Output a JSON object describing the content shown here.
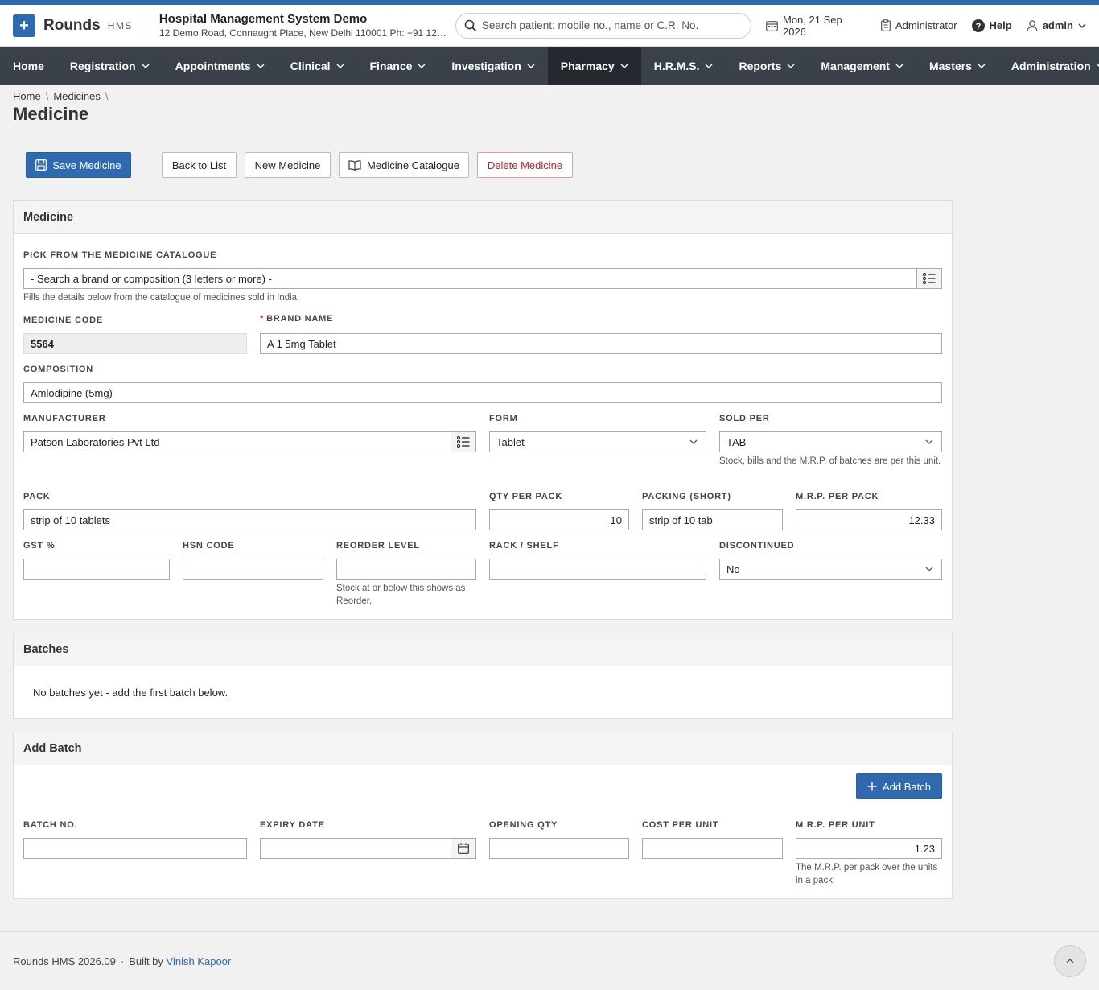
{
  "header": {
    "app_name": "Rounds",
    "app_sub": "HMS",
    "org_name": "Hospital Management System Demo",
    "org_address": "12 Demo Road, Connaught Place, New Delhi 110001 Ph: +91 123...",
    "search_placeholder": "Search patient: mobile no., name or C.R. No.",
    "date": "Mon, 21 Sep 2026",
    "role": "Administrator",
    "help": "Help",
    "user": "admin"
  },
  "nav": {
    "items": [
      {
        "label": "Home"
      },
      {
        "label": "Registration"
      },
      {
        "label": "Appointments"
      },
      {
        "label": "Clinical"
      },
      {
        "label": "Finance"
      },
      {
        "label": "Investigation"
      },
      {
        "label": "Pharmacy"
      },
      {
        "label": "H.R.M.S."
      },
      {
        "label": "Reports"
      },
      {
        "label": "Management"
      },
      {
        "label": "Masters"
      },
      {
        "label": "Administration"
      }
    ]
  },
  "breadcrumb": {
    "items": [
      "Home",
      "Medicines"
    ]
  },
  "page_title": "Medicine",
  "toolbar": {
    "save": "Save Medicine",
    "back": "Back to List",
    "new": "New Medicine",
    "catalogue": "Medicine Catalogue",
    "delete": "Delete Medicine"
  },
  "medicine": {
    "title": "Medicine",
    "pick_label": "Pick from the medicine catalogue",
    "pick_value": "- Search a brand or composition (3 letters or more) -",
    "pick_help": "Fills the details below from the catalogue of medicines sold in India.",
    "code_label": "Medicine Code",
    "code_value": "5564",
    "brand_label": "Brand Name",
    "brand_value": "A 1 5mg Tablet",
    "composition_label": "Composition",
    "composition_value": "Amlodipine (5mg)",
    "manufacturer_label": "Manufacturer",
    "manufacturer_value": "Patson Laboratories Pvt Ltd",
    "form_label": "Form",
    "form_value": "Tablet",
    "sold_per_label": "Sold per",
    "sold_per_value": "TAB",
    "sold_per_help": "Stock, bills and the M.R.P. of batches are per this unit.",
    "pack_label": "Pack",
    "pack_value": "strip of 10 tablets",
    "qty_label": "Qty per pack",
    "qty_value": "10",
    "packing_label": "Packing (short)",
    "packing_value": "strip of 10 tab",
    "mrp_pack_label": "M.R.P. per pack",
    "mrp_pack_value": "12.33",
    "gst_label": "GST %",
    "gst_value": "",
    "hsn_label": "HSN Code",
    "hsn_value": "",
    "reorder_label": "Reorder Level",
    "reorder_value": "",
    "reorder_help": "Stock at or below this shows as Reorder.",
    "rack_label": "Rack / Shelf",
    "rack_value": "",
    "discontinued_label": "Discontinued",
    "discontinued_value": "No"
  },
  "batches": {
    "title": "Batches",
    "empty": "No batches yet - add the first batch below."
  },
  "add_batch": {
    "title": "Add Batch",
    "button": "Add Batch",
    "batch_no_label": "Batch No.",
    "batch_no_value": "",
    "expiry_label": "Expiry Date",
    "expiry_value": "",
    "opening_qty_label": "Opening Qty",
    "opening_qty_value": "",
    "cost_label": "Cost per Unit",
    "cost_value": "",
    "mrp_unit_label": "M.R.P. per Unit",
    "mrp_unit_value": "1.23",
    "mrp_unit_help": "The M.R.P. per pack over the units in a pack."
  },
  "footer": {
    "text": "Rounds HMS 2026.09",
    "built_by": "Built by",
    "author": "Vinish Kapoor"
  },
  "colors": {
    "accent": "#2e6aad",
    "nav": "#3a4148",
    "nav_active": "#23292e",
    "danger": "#b02a2a"
  }
}
